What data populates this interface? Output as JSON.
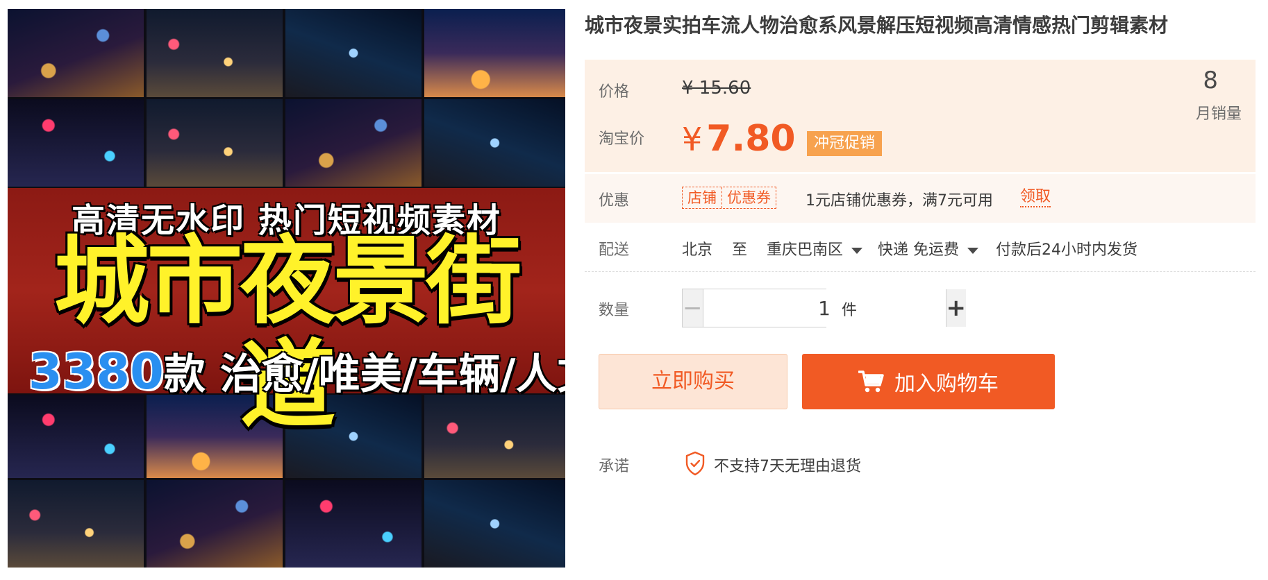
{
  "product": {
    "title": "城市夜景实拍车流人物治愈系风景解压短视频高清情感热门剪辑素材",
    "image": {
      "line1": "高清无水印  热门短视频素材",
      "main": "城市夜景街道",
      "count": "3380",
      "rest": "款  治愈/唯美/车辆/人文"
    }
  },
  "price": {
    "label": "价格",
    "original": "¥ 15.60",
    "taobao_label": "淘宝价",
    "yuan_symbol": "¥",
    "taobao_value": "7.80",
    "promo_badge": "冲冠促销",
    "monthly_sales_value": "8",
    "monthly_sales_label": "月销量"
  },
  "coupon": {
    "label": "优惠",
    "tag_left": "店铺",
    "tag_right": "优惠券",
    "text": "1元店铺优惠券，满7元可用",
    "claim": "领取"
  },
  "delivery": {
    "label": "配送",
    "from": "北京",
    "to_word": "至",
    "destination": "重庆巴南区",
    "method": "快递",
    "fee": "免运费",
    "shipping_time": "付款后24小时内发货"
  },
  "quantity": {
    "label": "数量",
    "minus": "−",
    "value": "1",
    "plus": "+",
    "unit": "件"
  },
  "actions": {
    "buy_now": "立即购买",
    "add_to_cart": "加入购物车"
  },
  "promise": {
    "label": "承诺",
    "text": "不支持7天无理由退货"
  },
  "colors": {
    "accent": "#f15a24",
    "price_panel_bg": "#fdf0e5",
    "promo_badge_bg": "#f7a24e",
    "buy_now_bg": "#fde5d6",
    "banner_yellow": "#fff22a",
    "banner_blue": "#2a8ff0",
    "banner_red": "#a2241b"
  },
  "icons": {
    "cart": "cart-icon",
    "promise": "shield-check-icon",
    "dropdown": "caret-down-icon"
  }
}
